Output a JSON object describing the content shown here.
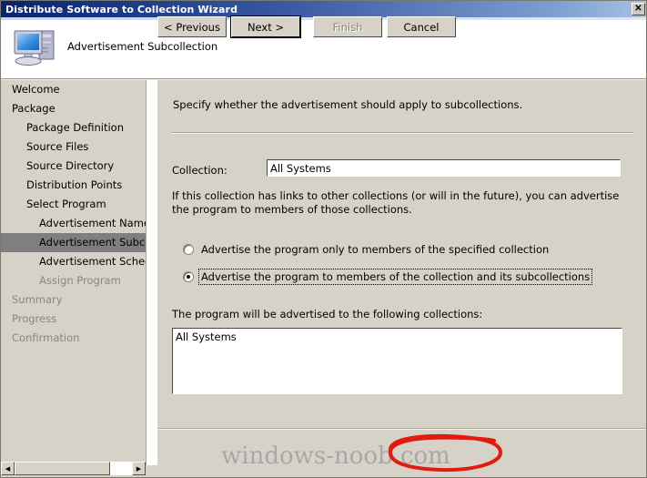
{
  "window": {
    "title": "Distribute Software to Collection Wizard",
    "close_label": "✕"
  },
  "header": {
    "title": "Advertisement Subcollection",
    "icon": "computer-icon"
  },
  "sidebar": {
    "items": [
      {
        "label": "Welcome",
        "level": 0,
        "state": "normal"
      },
      {
        "label": "Package",
        "level": 0,
        "state": "normal"
      },
      {
        "label": "Package Definition",
        "level": 1,
        "state": "normal"
      },
      {
        "label": "Source Files",
        "level": 1,
        "state": "normal"
      },
      {
        "label": "Source Directory",
        "level": 1,
        "state": "normal"
      },
      {
        "label": "Distribution Points",
        "level": 1,
        "state": "normal"
      },
      {
        "label": "Select Program",
        "level": 1,
        "state": "normal"
      },
      {
        "label": "Advertisement Name",
        "level": 2,
        "state": "normal"
      },
      {
        "label": "Advertisement Subcollection",
        "level": 2,
        "state": "selected"
      },
      {
        "label": "Advertisement Schedule",
        "level": 2,
        "state": "normal"
      },
      {
        "label": "Assign Program",
        "level": 2,
        "state": "disabled"
      },
      {
        "label": "Summary",
        "level": 0,
        "state": "disabled"
      },
      {
        "label": "Progress",
        "level": 0,
        "state": "disabled"
      },
      {
        "label": "Confirmation",
        "level": 0,
        "state": "disabled"
      }
    ],
    "scroll_left_arrow": "◀",
    "scroll_right_arrow": "▶"
  },
  "main": {
    "instruction": "Specify whether the advertisement should apply to subcollections.",
    "collection_label": "Collection:",
    "collection_value": "All Systems",
    "paragraph": "If this collection has links to other collections (or will in the future), you can advertise the program to members of those collections.",
    "radios": [
      {
        "label": "Advertise the program only to members of the specified collection",
        "selected": false,
        "focused": false
      },
      {
        "label": "Advertise the program to members of the collection and its subcollections",
        "selected": true,
        "focused": true
      }
    ],
    "list_caption": "The program will be advertised to the following collections:",
    "list_items": [
      "All Systems"
    ]
  },
  "footer": {
    "previous_label": "< Previous",
    "next_label": "Next >",
    "finish_label": "Finish",
    "cancel_label": "Cancel"
  },
  "watermark": {
    "text": "windows-noob.com"
  },
  "colors": {
    "window_face": "#d6d2c8",
    "title_left": "#0a246a",
    "title_right": "#a7c3e4",
    "selection": "#7f7f7f",
    "disabled_text": "#8a867e",
    "annotation_red": "#e01b10",
    "watermark_gray": "#a8a8a8"
  }
}
